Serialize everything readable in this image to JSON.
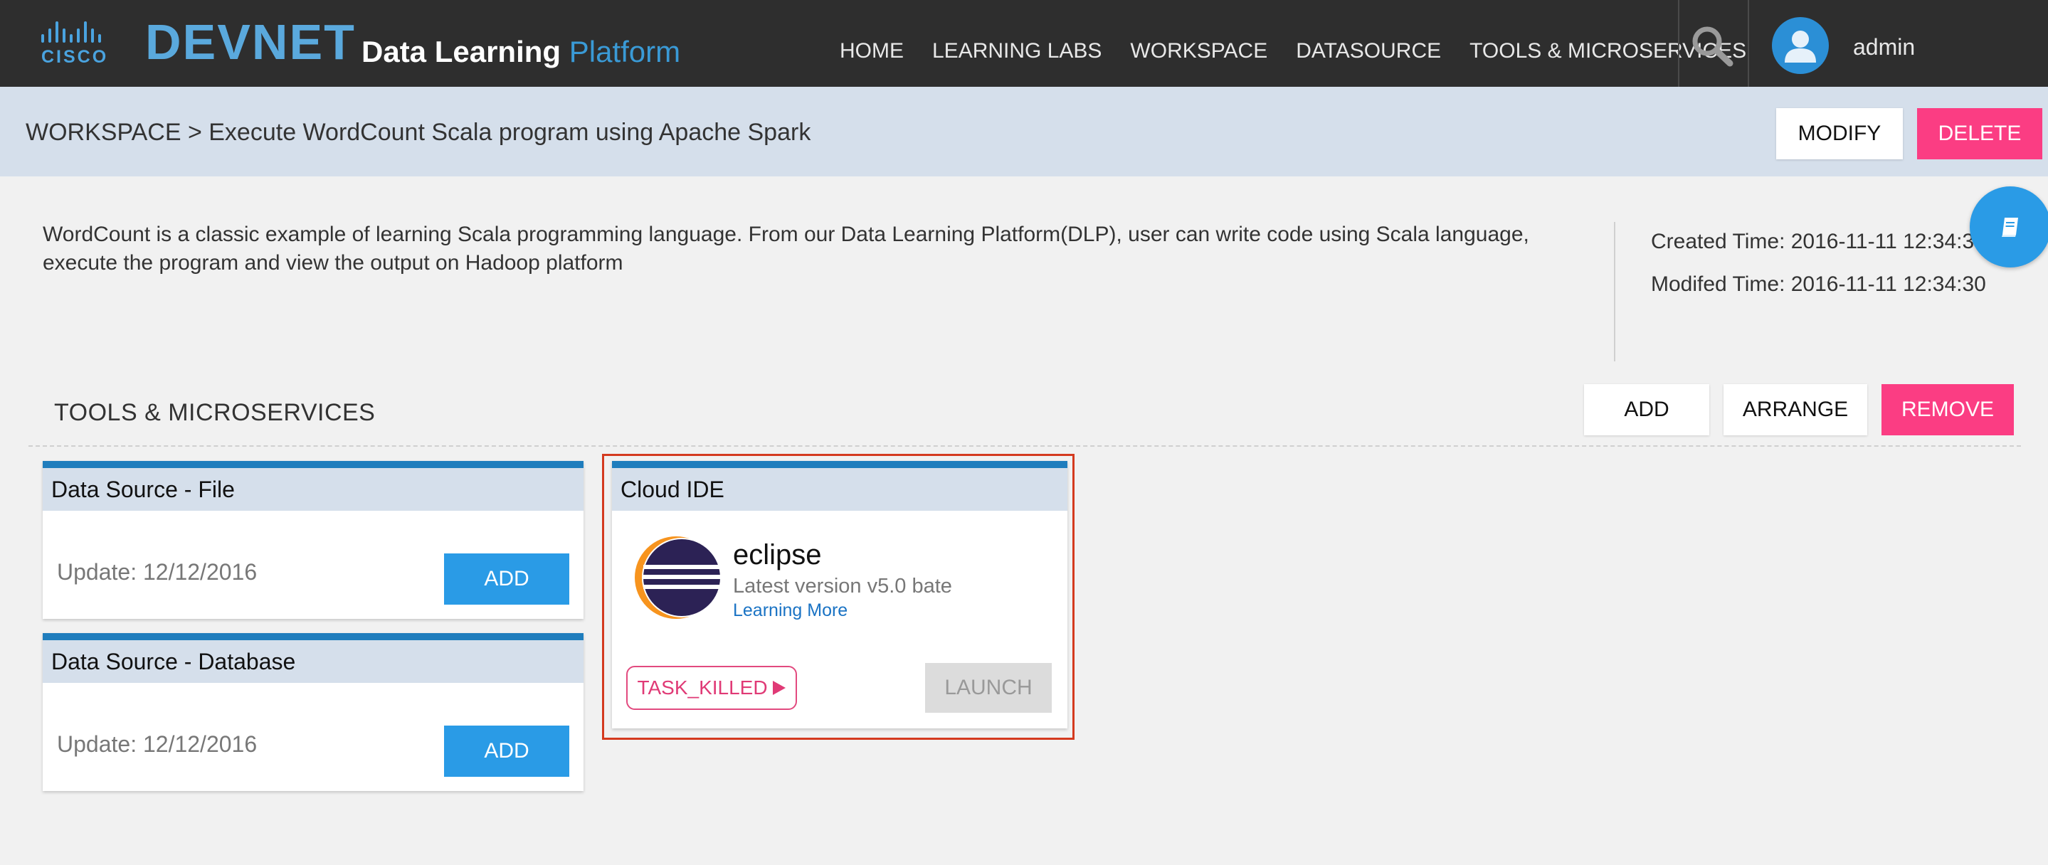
{
  "header": {
    "cisco_text": "CISCO",
    "devnet_text": "DEVNET",
    "title_bold": "Data Learning",
    "title_light": "Platform",
    "nav": [
      {
        "label": "HOME"
      },
      {
        "label": "LEARNING LABS"
      },
      {
        "label": "WORKSPACE"
      },
      {
        "label": "DATASOURCE"
      },
      {
        "label": "TOOLS & MICROSERVICES"
      }
    ],
    "user_name": "admin"
  },
  "breadcrumb": {
    "text": "WORKSPACE > Execute WordCount Scala program using Apache Spark",
    "modify_label": "MODIFY",
    "delete_label": "DELETE"
  },
  "workspace": {
    "description": "WordCount is a classic example of learning Scala programming language. From our Data Learning Platform(DLP), user can write code using Scala language, execute the program and view the output on Hadoop platform",
    "created": "Created Time: 2016-11-11 12:34:30",
    "modified": "Modifed Time: 2016-11-11 12:34:30"
  },
  "tools": {
    "title": "TOOLS & MICROSERVICES",
    "add_label": "ADD",
    "arrange_label": "ARRANGE",
    "remove_label": "REMOVE",
    "cards": [
      {
        "title": "Data Source - File",
        "update": "Update: 12/12/2016",
        "button": "ADD"
      },
      {
        "title": "Data Source - Database",
        "update": "Update: 12/12/2016",
        "button": "ADD"
      }
    ],
    "cloud_ide": {
      "title": "Cloud IDE",
      "name": "eclipse",
      "version": "Latest version v5.0 bate",
      "link": "Learning More",
      "status": "TASK_KILLED",
      "launch_label": "LAUNCH"
    }
  },
  "colors": {
    "nav_bg": "#2e2e2e",
    "crumb_bg": "#d5dfeb",
    "accent_blue": "#2a9be6",
    "accent_pink": "#fb3d83",
    "card_top_border": "#1f7dbd",
    "highlight_border": "#d43a1f"
  },
  "icons": [
    "search-icon",
    "user-avatar-icon",
    "book-icon",
    "eclipse-logo-icon",
    "play-icon"
  ]
}
